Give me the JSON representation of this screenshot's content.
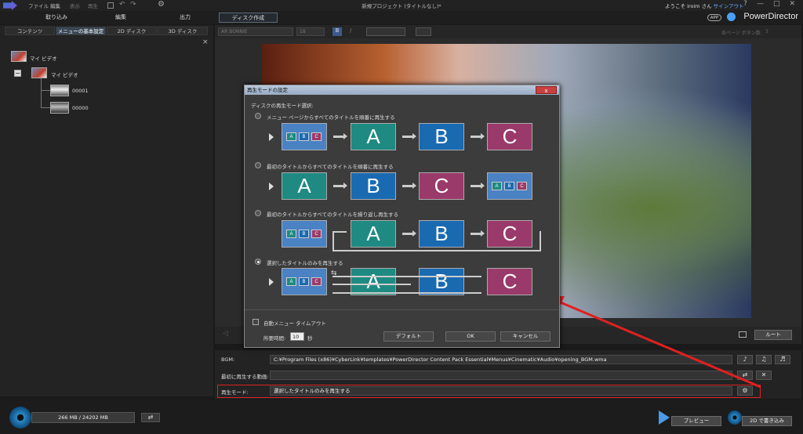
{
  "menubar": {
    "items": [
      "ファイル",
      "編集",
      "表示",
      "再生"
    ],
    "title": "新規プロジェクト (タイトルなし)*"
  },
  "modes": {
    "tabs": [
      "取り込み",
      "編集",
      "出力",
      "ディスク作成"
    ]
  },
  "header": {
    "welcome": "ようこそ iroim さん",
    "signin": "サインアウト",
    "app": "APP",
    "brand": "PowerDirector"
  },
  "left": {
    "tabs": [
      "コンテンツ",
      "メニューの基本設定",
      "2D ディスク",
      "3D ディスク"
    ],
    "close": "×",
    "root": "マイ ビデオ",
    "child": "マイ ビデオ",
    "clips": [
      "00001",
      "00000"
    ],
    "expand": "−"
  },
  "toolbar": {
    "font": "AR BONNIE",
    "size": "18",
    "bold": "B",
    "italic": "I",
    "per_page": "各ページ ボタン数:",
    "per_page_value": "3"
  },
  "preview": {
    "overlay": "マイ ビデオ"
  },
  "controls": {
    "root_label": "ルート"
  },
  "bgm": {
    "bgm_label": "BGM:",
    "bgm_path": "C:¥Program Files (x86)¥CyberLink¥templates¥PowerDirector Content Pack Essential¥Menus¥Cinematic¥Audio¥opening_BGM.wma",
    "first_label": "最初に再生する動画:",
    "first_value": "",
    "mode_label": "再生モード:",
    "mode_value": "選択したタイトルのみを再生する"
  },
  "bottom": {
    "capacity": "266 MB / 24202 MB",
    "preview": "プレビュー",
    "burn": "2D で書き込み"
  },
  "dialog": {
    "title": "再生モードの設定",
    "close": "x",
    "section": "ディスクの再生モード選択:",
    "options": [
      "メニュー ページからすべてのタイトルを順番に再生する",
      "最初のタイトルからすべてのタイトルを順番に再生する",
      "最初のタイトルからすべてのタイトルを繰り返し再生する",
      "選択したタイトルのみを再生する"
    ],
    "selected_option": 3,
    "cards": {
      "a": "A",
      "b": "B",
      "c": "C"
    },
    "autoplay_label": "自動メニュー タイムアウト",
    "duration_label": "所要時間:",
    "duration_value": "10",
    "seconds": "秒",
    "buttons": {
      "default": "デフォルト",
      "ok": "OK",
      "cancel": "キャンセル"
    }
  },
  "colors": {
    "card_a": "#1e8a82",
    "card_b": "#1a6ab2",
    "card_c": "#9a3a6a",
    "menu_card": "#4a82c4",
    "annotation": "#e02020"
  }
}
